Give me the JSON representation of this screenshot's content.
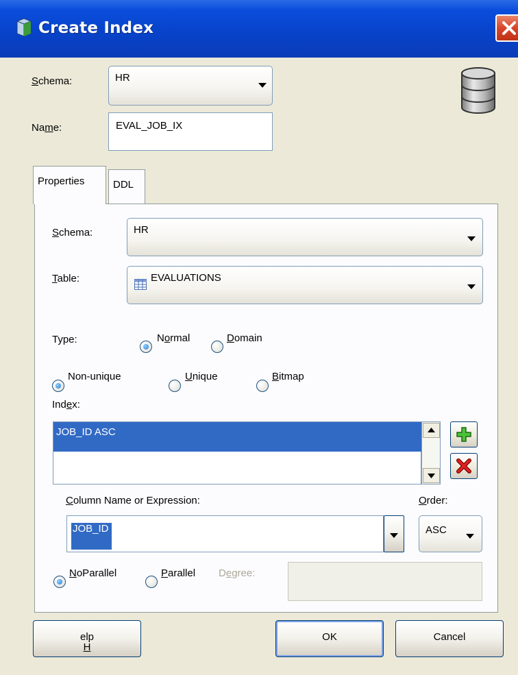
{
  "window": {
    "title": "Create Index"
  },
  "schema": {
    "label": "Schema:",
    "value": "HR"
  },
  "name": {
    "label": "Name:",
    "value": "EVAL_JOB_IX"
  },
  "tabs": [
    {
      "label": "Properties"
    },
    {
      "label": "DDL"
    }
  ],
  "properties": {
    "schema": {
      "label": "Schema:",
      "value": "HR"
    },
    "table": {
      "label": "Table:",
      "value": "EVALUATIONS"
    },
    "type": {
      "label": "Type:",
      "normal": "Normal",
      "domain": "Domain",
      "selected": "Normal"
    },
    "uniqueness": {
      "non_unique": "Non-unique",
      "unique": "Unique",
      "bitmap": "Bitmap",
      "selected": "Non-unique"
    },
    "index": {
      "label": "Index:",
      "items": [
        "JOB_ID ASC"
      ]
    },
    "column": {
      "label": "Column Name or Expression:",
      "value": "JOB_ID"
    },
    "order": {
      "label": "Order:",
      "value": "ASC"
    },
    "parallel": {
      "noparallel": "NoParallel",
      "parallel": "Parallel",
      "degree_label": "Degree:",
      "degree_value": "",
      "selected": "NoParallel"
    }
  },
  "buttons": {
    "help": "Help",
    "ok": "OK",
    "cancel": "Cancel"
  },
  "icons": {
    "title": "index-icon",
    "close": "close-icon",
    "database": "database-icon",
    "table": "table-icon",
    "add": "plus-icon",
    "delete": "delete-x-icon"
  }
}
